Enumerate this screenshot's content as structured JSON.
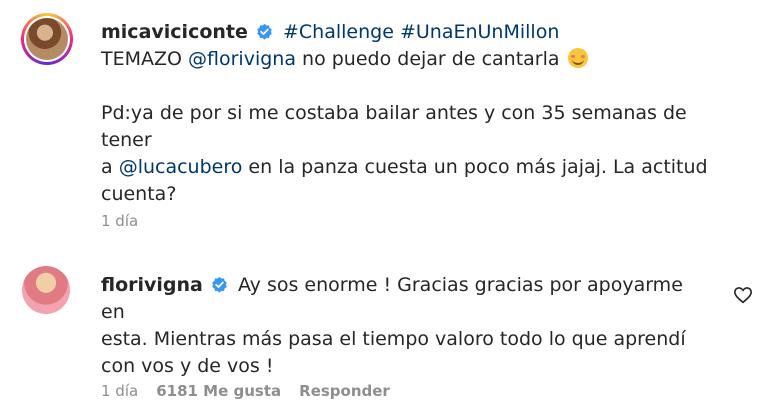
{
  "comments": [
    {
      "username": "micaviciconte",
      "hashtags": [
        "#Challenge",
        "#UnaEnUnMillon"
      ],
      "line1_prefix": "TEMAZO",
      "line1_mention": "@florivigna",
      "line1_suffix": "no puedo dejar de cantarla",
      "line2_prefix": "Pd:ya de por si me costaba bailar antes y con 35 semanas de tener",
      "line3_prefix": "a",
      "line3_mention": "@lucacubero",
      "line3_suffix": "en la panza cuesta un poco más jajaj. La actitud",
      "line4": "cuenta?",
      "time": "1 día",
      "emoji_icon": "smiling-face-with-hearts"
    },
    {
      "username": "florivigna",
      "text_line1": "Ay sos enorme ! Gracias gracias por apoyarme en",
      "text_line2": "esta. Mientras más pasa el tiempo valoro todo lo que aprendí",
      "text_line3": "con vos y de vos !",
      "time": "1 día",
      "likes": "6181 Me gusta",
      "reply_label": "Responder",
      "like_icon": "heart-outline"
    }
  ],
  "colors": {
    "text": "#262626",
    "link": "#00376b",
    "muted": "#8e8e8e",
    "verified": "#3897f0"
  }
}
